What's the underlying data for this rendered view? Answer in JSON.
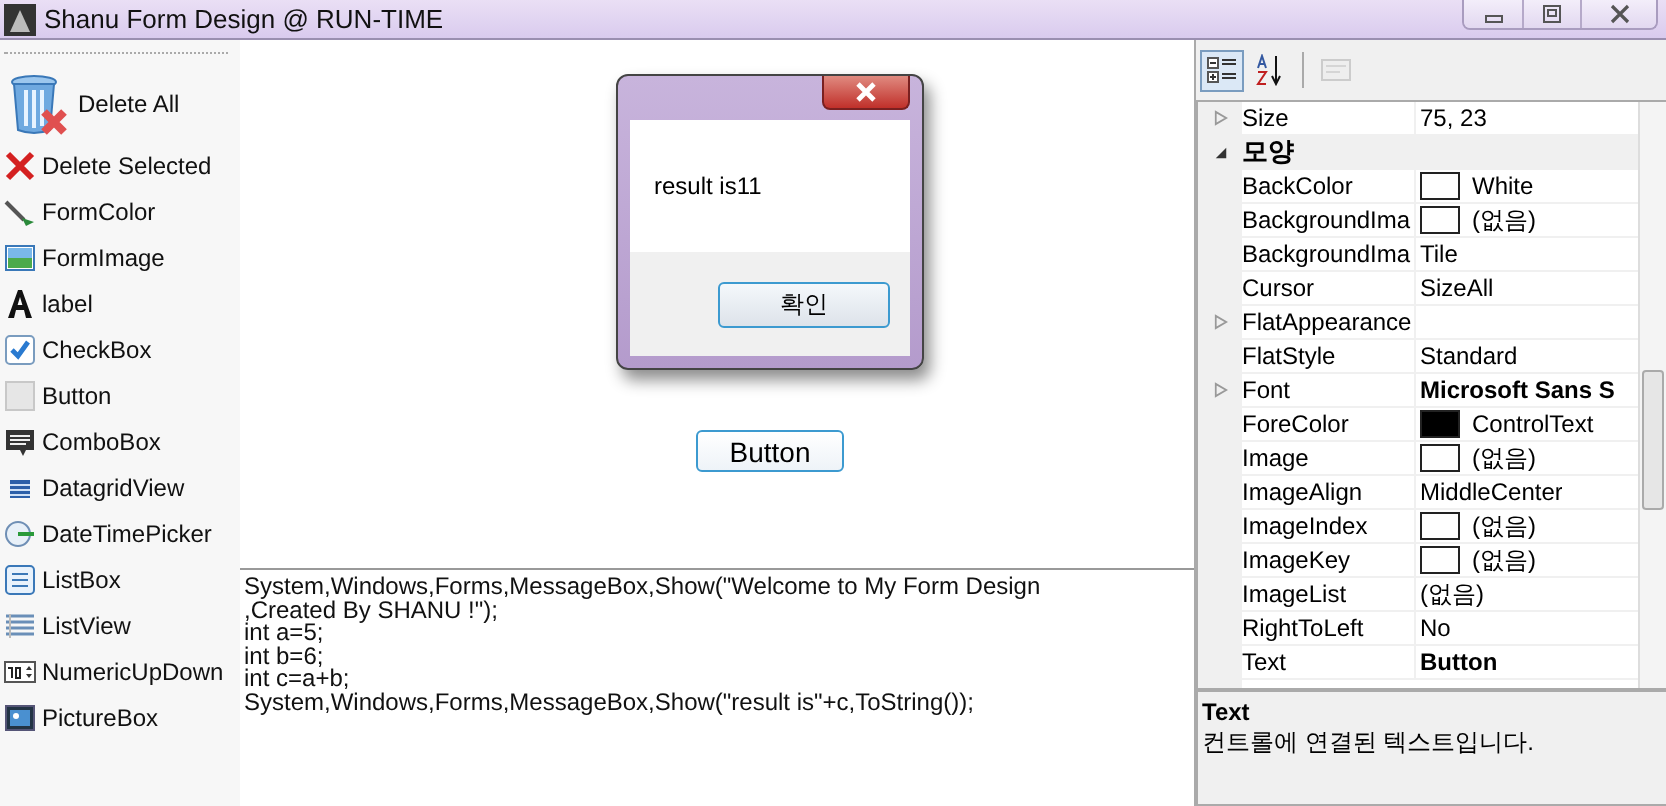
{
  "window": {
    "title": "Shanu Form Design @ RUN-TIME"
  },
  "toolbox": [
    {
      "label": "Delete All"
    },
    {
      "label": "Delete Selected"
    },
    {
      "label": "FormColor"
    },
    {
      "label": "FormImage"
    },
    {
      "label": "label"
    },
    {
      "label": "CheckBox"
    },
    {
      "label": "Button"
    },
    {
      "label": "ComboBox"
    },
    {
      "label": "DatagridView"
    },
    {
      "label": "DateTimePicker"
    },
    {
      "label": "ListBox"
    },
    {
      "label": "ListView"
    },
    {
      "label": "NumericUpDown"
    },
    {
      "label": "PictureBox"
    }
  ],
  "form_button": {
    "label": "Button"
  },
  "message_box": {
    "text": "result is11",
    "ok_button": "확인"
  },
  "code_lines": [
    "System,Windows,Forms,MessageBox,Show(\"Welcome to My Form Design",
    ",Created By SHANU !\");",
    "int a=5;",
    "int b=6;",
    "int c=a+b;",
    "System,Windows,Forms,MessageBox,Show(\"result is\"+c,ToString());"
  ],
  "property_toolbar": [
    {
      "selected": true,
      "disabled": false
    },
    {
      "selected": false,
      "disabled": false
    },
    {
      "selected": false,
      "disabled": true
    }
  ],
  "properties": [
    {
      "kind": "group",
      "name": "Size",
      "value": "75, 23",
      "bold": false,
      "expanded": false
    },
    {
      "kind": "category",
      "name": "모양",
      "expanded": true
    },
    {
      "kind": "property",
      "name": "BackColor",
      "value": "White",
      "bold": false,
      "color": "#ffffff"
    },
    {
      "kind": "property",
      "name": "BackgroundIma",
      "value": "(없음)",
      "bold": false,
      "color": "#ffffff"
    },
    {
      "kind": "property",
      "name": "BackgroundIma",
      "value": "Tile",
      "bold": false
    },
    {
      "kind": "property",
      "name": "Cursor",
      "value": "SizeAll",
      "bold": false
    },
    {
      "kind": "group",
      "name": "FlatAppearance",
      "expanded": false
    },
    {
      "kind": "property",
      "name": "FlatStyle",
      "value": "Standard",
      "bold": false
    },
    {
      "kind": "group",
      "name": "Font",
      "value": "Microsoft Sans S",
      "bold": true,
      "expanded": false
    },
    {
      "kind": "property",
      "name": "ForeColor",
      "value": "ControlText",
      "bold": false,
      "color": "#000000"
    },
    {
      "kind": "property",
      "name": "Image",
      "value": "(없음)",
      "bold": false,
      "color": "#ffffff"
    },
    {
      "kind": "property",
      "name": "ImageAlign",
      "value": "MiddleCenter",
      "bold": false
    },
    {
      "kind": "property",
      "name": "ImageIndex",
      "value": "(없음)",
      "bold": false,
      "color": "#ffffff"
    },
    {
      "kind": "property",
      "name": "ImageKey",
      "value": "(없음)",
      "bold": false,
      "color": "#ffffff"
    },
    {
      "kind": "property",
      "name": "ImageList",
      "value": "(없음)",
      "bold": false
    },
    {
      "kind": "property",
      "name": "RightToLeft",
      "value": "No",
      "bold": false
    },
    {
      "kind": "property",
      "name": "Text",
      "value": "Button",
      "bold": true
    }
  ],
  "description": {
    "title": "Text",
    "text": "컨트롤에 연결된 텍스트입니다."
  }
}
